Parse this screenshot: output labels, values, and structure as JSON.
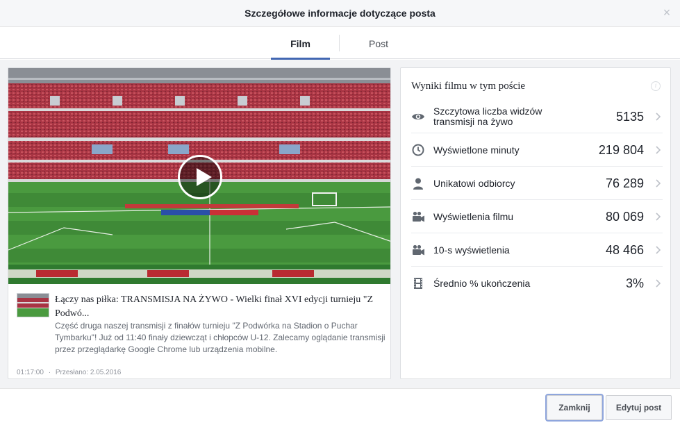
{
  "dialog": {
    "title": "Szczegółowe informacje dotyczące posta",
    "close_glyph": "×"
  },
  "tabs": [
    {
      "label": "Film",
      "active": true
    },
    {
      "label": "Post",
      "active": false
    }
  ],
  "post": {
    "title": "Łączy nas piłka: TRANSMISJA NA ŻYWO - Wielki finał XVI edycji turnieju \"Z Podwó...",
    "description": "Część druga naszej transmisji z finałów turnieju \"Z Podwórka na Stadion o Puchar Tymbarku\"! Już od 11:40 finały dziewcząt i chłopców U-12. Zalecamy oglądanie transmisji przez przeglądarkę Google Chrome lub urządzenia mobilne.",
    "duration": "01:17:00",
    "separator": "·",
    "uploaded": "Przesłano: 2.05.2016"
  },
  "results": {
    "title": "Wyniki filmu w tym poście",
    "info_glyph": "i",
    "metrics": [
      {
        "icon": "eye-icon",
        "label": "Szczytowa liczba widzów transmisji na żywo",
        "value": "5135"
      },
      {
        "icon": "clock-icon",
        "label": "Wyświetlone minuty",
        "value": "219 804"
      },
      {
        "icon": "person-icon",
        "label": "Unikatowi odbiorcy",
        "value": "76 289"
      },
      {
        "icon": "video-camera-icon",
        "label": "Wyświetlenia filmu",
        "value": "80 069"
      },
      {
        "icon": "video-camera-icon",
        "label": "10-s wyświetlenia",
        "value": "48 466"
      },
      {
        "icon": "film-strip-icon",
        "label": "Średnio % ukończenia",
        "value": "3%"
      }
    ]
  },
  "footer": {
    "close_label": "Zamknij",
    "edit_label": "Edytuj post"
  },
  "colors": {
    "accent": "#4267b2",
    "pitch": "#3f8c3a",
    "seats": "#b33a48"
  }
}
